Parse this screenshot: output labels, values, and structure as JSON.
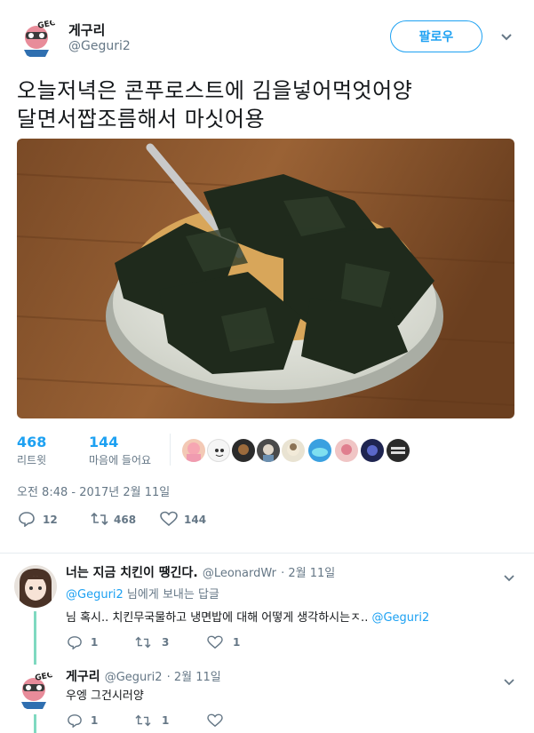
{
  "header": {
    "display_name": "게구리",
    "handle": "@Geguri2",
    "follow_label": "팔로우",
    "avatar_text": "GEGURI2"
  },
  "tweet": {
    "text_line1": "오늘저녁은 콘푸로스트에 김을넣어먹엇어양",
    "text_line2": "달면서짭조름해서 마싯어용",
    "retweets_count": "468",
    "retweets_label": "리트윗",
    "likes_count": "144",
    "likes_label": "마음에 들어요",
    "timestamp": "오전 8:48 - 2017년 2월 11일",
    "action_reply_count": "12",
    "action_retweet_count": "468",
    "action_like_count": "144"
  },
  "replies": [
    {
      "display_name": "너는 지금 치킨이 땡긴다.",
      "handle": "@LeonardWr",
      "date": "· 2월 11일",
      "replying_to_handle": "@Geguri2",
      "replying_to_suffix": " 님에게 보내는 답글",
      "text": "님 혹시.. 치킨무국물하고 냉면밥에 대해 어떻게 생각하시는ㅈ..",
      "text_mention": "@Geguri2",
      "reply_count": "1",
      "retweet_count": "3",
      "like_count": "1"
    },
    {
      "display_name": "게구리",
      "handle": "@Geguri2",
      "date": "· 2월 11일",
      "text": "우엥 그건시러양",
      "reply_count": "1",
      "retweet_count": "1",
      "like_count": ""
    }
  ],
  "colors": {
    "accent": "#1da1f2",
    "thread_line": "#7fd9c0",
    "muted": "#657786"
  }
}
